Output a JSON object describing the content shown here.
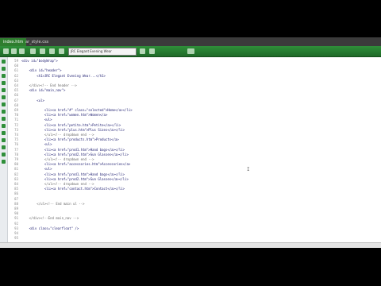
{
  "tabs": [
    {
      "label": "index.htm",
      "active": true
    },
    {
      "label": "ar_style.css",
      "active": false
    }
  ],
  "toolbar": {
    "title_field": "JRC Elegant Evening Wear"
  },
  "editor": {
    "lines": [
      {
        "n": "59",
        "t": "<div id=\"bodyWrap\">",
        "c": false
      },
      {
        "n": "60",
        "t": "",
        "c": false
      },
      {
        "n": "61",
        "t": "    <div id=\"header\">",
        "c": false
      },
      {
        "n": "62",
        "t": "        <h1>JRC Elegant Evening Wear...</h1>",
        "c": false
      },
      {
        "n": "63",
        "t": "",
        "c": false
      },
      {
        "n": "64",
        "t": "    </div><!-- End header -->",
        "c": true
      },
      {
        "n": "65",
        "t": "    <div id=\"main_nav\">",
        "c": false
      },
      {
        "n": "66",
        "t": "",
        "c": false
      },
      {
        "n": "67",
        "t": "        <ul>",
        "c": false
      },
      {
        "n": "68",
        "t": "",
        "c": false
      },
      {
        "n": "69",
        "t": "            <li><a href=\"#\" class=\"selected\">Home</a></li>",
        "c": false
      },
      {
        "n": "70",
        "t": "            <li><a href=\"women.htm\">Women</a>",
        "c": false
      },
      {
        "n": "71",
        "t": "            <ul>",
        "c": false
      },
      {
        "n": "72",
        "t": "            <li><a href=\"petite.htm\">Petite</a></li>",
        "c": false
      },
      {
        "n": "73",
        "t": "            <li><a href=\"plus.htm\">Plus Sizes</a></li>",
        "c": false
      },
      {
        "n": "74",
        "t": "            </ul><!-- dropdown end -->",
        "c": true
      },
      {
        "n": "75",
        "t": "            <li><a href=\"products.htm\">Products</a>",
        "c": false
      },
      {
        "n": "76",
        "t": "            <ul>",
        "c": false
      },
      {
        "n": "77",
        "t": "            <li><a href=\"prod1.htm\">Hand bags</a></li>",
        "c": false
      },
      {
        "n": "78",
        "t": "            <li><a href=\"prod2.htm\">Sun Glasses</a></li>",
        "c": false
      },
      {
        "n": "79",
        "t": "            </ul><!-- dropdown end -->",
        "c": true
      },
      {
        "n": "80",
        "t": "            <li><a href=\"accessories.htm\">Accessories</a>",
        "c": false
      },
      {
        "n": "81",
        "t": "            <ul>",
        "c": false
      },
      {
        "n": "82",
        "t": "            <li><a href=\"prod1.htm\">Hand bags</a></li>",
        "c": false
      },
      {
        "n": "83",
        "t": "            <li><a href=\"prod2.htm\">Sun Glasses</a></li>",
        "c": false
      },
      {
        "n": "84",
        "t": "            </ul><!-- dropdown end -->",
        "c": true
      },
      {
        "n": "85",
        "t": "            <li><a href=\"contact.htm\">Contact</a></li>",
        "c": false
      },
      {
        "n": "86",
        "t": "",
        "c": false
      },
      {
        "n": "87",
        "t": "",
        "c": false
      },
      {
        "n": "88",
        "t": "        </ul><!-- End main ul -->",
        "c": true
      },
      {
        "n": "89",
        "t": "",
        "c": false
      },
      {
        "n": "90",
        "t": "",
        "c": false
      },
      {
        "n": "91",
        "t": "    </div><!--End main_nav -->",
        "c": true
      },
      {
        "n": "92",
        "t": "",
        "c": false
      },
      {
        "n": "93",
        "t": "    <div class=\"clearfloat\" />",
        "c": false
      },
      {
        "n": "94",
        "t": "",
        "c": false
      },
      {
        "n": "95",
        "t": "",
        "c": false
      }
    ],
    "cursor_glyph": "I"
  },
  "colors": {
    "toolbar_green": "#2f8f3a",
    "code_text": "#1a1a6e",
    "background": "#000000"
  }
}
